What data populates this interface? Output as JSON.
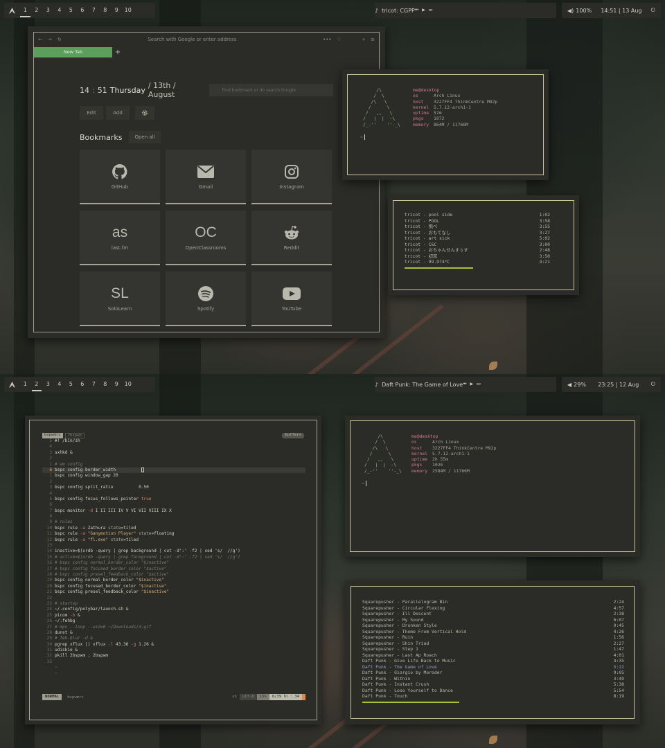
{
  "top": {
    "bar": {
      "workspaces": [
        "1",
        "2",
        "3",
        "4",
        "5",
        "6",
        "7",
        "8",
        "9",
        "10"
      ],
      "active": 0,
      "now_playing": "tricot: CGPP",
      "volume": "100%",
      "clock": "14:51 | 13 Aug"
    },
    "browser": {
      "address_placeholder": "Search with Google or enter address",
      "tab": "New Tab",
      "time_hour": "14",
      "time_minute": "51",
      "day": "Thursday",
      "date_rest": "/ 13th / August",
      "search_placeholder": "Find bookmark or do search Google",
      "edit": "Edit",
      "add": "Add",
      "bookmarks_heading": "Bookmarks",
      "open_all": "Open all",
      "bookmarks": [
        {
          "label": "GitHub",
          "icon": "github-icon"
        },
        {
          "label": "Gmail",
          "icon": "mail-icon"
        },
        {
          "label": "Instagram",
          "icon": "instagram-icon"
        },
        {
          "label": "last.fm",
          "icon": "lastfm-icon",
          "glyph": "as"
        },
        {
          "label": "OpenClassrooms",
          "icon": "openclassrooms-icon",
          "glyph": "OC"
        },
        {
          "label": "Reddit",
          "icon": "reddit-icon"
        },
        {
          "label": "SoloLearn",
          "icon": "sololearn-icon",
          "glyph": "SL"
        },
        {
          "label": "Spotify",
          "icon": "spotify-icon"
        },
        {
          "label": "YouTube",
          "icon": "youtube-icon"
        }
      ]
    },
    "neofetch": {
      "userhost": "me@desktop",
      "rows": [
        {
          "k": "os",
          "v": "Arch Linux"
        },
        {
          "k": "host",
          "v": "3227FF4 ThinkCentre M92p"
        },
        {
          "k": "kernel",
          "v": "5.7.12-arch1-1"
        },
        {
          "k": "uptime",
          "v": "57m"
        },
        {
          "k": "pkgs",
          "v": "1072"
        },
        {
          "k": "memory",
          "v": "864M / 11766M"
        }
      ],
      "prompt": "~"
    },
    "playlist": [
      {
        "t": "tricot - pool side",
        "d": "1:02"
      },
      {
        "t": "tricot - POOL",
        "d": "3:58"
      },
      {
        "t": "tricot - 飛べ",
        "d": "3:55"
      },
      {
        "t": "tricot - おもてなし",
        "d": "3:27"
      },
      {
        "t": "tricot - art sick",
        "d": "5:02"
      },
      {
        "t": "tricot - C&C",
        "d": "3:00"
      },
      {
        "t": "tricot - おちゃんせんすぅす",
        "d": "2:48"
      },
      {
        "t": "tricot - 初耳",
        "d": "3:50"
      },
      {
        "t": "tricot - 99.974℃",
        "d": "4:21"
      }
    ],
    "playlist_progress": 0.47
  },
  "bottom": {
    "bar": {
      "workspaces": [
        "1",
        "2",
        "3",
        "4",
        "5",
        "6",
        "7",
        "8",
        "9",
        "10"
      ],
      "active": 1,
      "now_playing": "Daft Punk: The Game of Love",
      "volume": "29%",
      "clock": "23:25 | 12 Aug"
    },
    "vim": {
      "tab_active": "bspwmrc",
      "tab_other": "2bspwm",
      "buffers": "buffers",
      "mode": "NORMAL",
      "file": "bspwmrc",
      "ft": "sh",
      "enc": "utf-8",
      "percent": "15%",
      "pos": "6/39 ㏑ : 34"
    },
    "neofetch": {
      "userhost": "me@desktop",
      "rows": [
        {
          "k": "os",
          "v": "Arch Linux"
        },
        {
          "k": "host",
          "v": "3227FF4 ThinkCentre M92p"
        },
        {
          "k": "kernel",
          "v": "5.7.12-arch1-1"
        },
        {
          "k": "uptime",
          "v": "2h 55m"
        },
        {
          "k": "pkgs",
          "v": "1026"
        },
        {
          "k": "memory",
          "v": "2584M / 11766M"
        }
      ],
      "prompt": "~"
    },
    "playlist": [
      {
        "t": "Squarepusher - Parallelogram Bin",
        "d": "2:24"
      },
      {
        "t": "Squarepusher - Circular Flexing",
        "d": "4:57"
      },
      {
        "t": "Squarepusher - Ill Descent",
        "d": "2:38"
      },
      {
        "t": "Squarepusher - My Sound",
        "d": "6:07"
      },
      {
        "t": "Squarepusher - Drunken Style",
        "d": "0:45"
      },
      {
        "t": "Squarepusher - Theme From Vertical Hold",
        "d": "4:26"
      },
      {
        "t": "Squarepusher - Ruin",
        "d": "1:56"
      },
      {
        "t": "Squarepusher - Shin Triad",
        "d": "2:27"
      },
      {
        "t": "Squarepusher - Step 1",
        "d": "1:47"
      },
      {
        "t": "Squarepusher - Last Ap Roach",
        "d": "4:01"
      },
      {
        "t": "Daft Punk - Give Life Back to Music",
        "d": "4:35"
      },
      {
        "t": "Daft Punk - The Game of Love",
        "d": "5:22",
        "playing": true
      },
      {
        "t": "Daft Punk - Giorgio by Moroder",
        "d": "9:05"
      },
      {
        "t": "Daft Punk - Within",
        "d": "3:49"
      },
      {
        "t": "Daft Punk - Instant Crush",
        "d": "5:38"
      },
      {
        "t": "Daft Punk - Lose Yourself to Dance",
        "d": "5:54"
      },
      {
        "t": "Daft Punk - Touch",
        "d": "8:19"
      }
    ],
    "playlist_progress": 0.37
  },
  "ascii_logo": "     /\\\n    /  \\\n   /\\   \\\n  /      \\\n /   ,,   \\\n/   |  |  -\\\n/_-''    ''-_\\",
  "code": [
    {
      "n": "5",
      "h": [
        [
          "txt",
          "#! /bin/sh"
        ]
      ]
    },
    {
      "n": "4",
      "h": []
    },
    {
      "n": "3",
      "h": [
        [
          "txt",
          "sxhkd &"
        ]
      ]
    },
    {
      "n": "2",
      "h": []
    },
    {
      "n": "1",
      "h": [
        [
          "cm",
          "# wm config"
        ]
      ]
    },
    {
      "n": "6",
      "cur": true,
      "h": [
        [
          "txt",
          "bspc config border_width          "
        ],
        [
          "box",
          ""
        ]
      ]
    },
    {
      "n": "1",
      "h": [
        [
          "txt",
          "bspc config window_gap 20"
        ]
      ]
    },
    {
      "n": "2",
      "h": []
    },
    {
      "n": "3",
      "h": [
        [
          "txt",
          "bspc config split_ratio          0.50"
        ]
      ]
    },
    {
      "n": "4",
      "h": []
    },
    {
      "n": "5",
      "h": [
        [
          "txt",
          "bspc config focus_follows_pointer "
        ],
        [
          "or",
          "true"
        ]
      ]
    },
    {
      "n": "6",
      "h": []
    },
    {
      "n": "7",
      "h": [
        [
          "txt",
          "bspc monitor "
        ],
        [
          "pk",
          "-d"
        ],
        [
          "txt",
          " I II III IV V VI VII VIII IX X"
        ]
      ]
    },
    {
      "n": "8",
      "h": []
    },
    {
      "n": "9",
      "h": [
        [
          "cm",
          "# rules"
        ]
      ]
    },
    {
      "n": "10",
      "h": [
        [
          "txt",
          "bspc rule "
        ],
        [
          "pk",
          "-a"
        ],
        [
          "txt",
          " Zathura "
        ],
        [
          "kw",
          "state"
        ],
        [
          "txt",
          "=tiled"
        ]
      ]
    },
    {
      "n": "11",
      "h": [
        [
          "txt",
          "bspc rule "
        ],
        [
          "pk",
          "-a"
        ],
        [
          "txt",
          " "
        ],
        [
          "st",
          "\"Ganymotion Player\""
        ],
        [
          "txt",
          " "
        ],
        [
          "kw",
          "state"
        ],
        [
          "txt",
          "=floating"
        ]
      ]
    },
    {
      "n": "12",
      "h": [
        [
          "txt",
          "bspc rule "
        ],
        [
          "pk",
          "-a"
        ],
        [
          "txt",
          " "
        ],
        [
          "st",
          "\"fl.exe\""
        ],
        [
          "txt",
          " "
        ],
        [
          "kw",
          "state"
        ],
        [
          "txt",
          "=tiled"
        ]
      ]
    },
    {
      "n": "13",
      "h": []
    },
    {
      "n": "14",
      "h": [
        [
          "txt",
          "inactive=$(xrdb -query | grep background | cut -d':' -f2 | sed 's/  //g')"
        ]
      ]
    },
    {
      "n": "15",
      "h": [
        [
          "cm",
          "# active=$(xrdb -query | grep foreground | cut -d':' -f2 | sed 's/  //g')"
        ]
      ]
    },
    {
      "n": "16",
      "h": [
        [
          "cm",
          "# bspc config normal_border_color \"$inactive\""
        ]
      ]
    },
    {
      "n": "17",
      "h": [
        [
          "cm",
          "# bspc config focused_border_color \"$active\""
        ]
      ]
    },
    {
      "n": "18",
      "h": [
        [
          "cm",
          "# bspc config presel_feedback_color \"$active\""
        ]
      ]
    },
    {
      "n": "19",
      "h": [
        [
          "txt",
          "bspc config normal_border_color "
        ],
        [
          "st",
          "\"$inactive\""
        ]
      ]
    },
    {
      "n": "20",
      "h": [
        [
          "txt",
          "bspc config focused_border_color "
        ],
        [
          "st",
          "\"$inactive\""
        ]
      ]
    },
    {
      "n": "21",
      "h": [
        [
          "txt",
          "bspc config presel_feedback_color "
        ],
        [
          "st",
          "\"$inactive\""
        ]
      ]
    },
    {
      "n": "22",
      "h": []
    },
    {
      "n": "23",
      "h": [
        [
          "cm",
          "# startup"
        ]
      ]
    },
    {
      "n": "24",
      "h": [
        [
          "txt",
          "~/.config/polybar/launch.sh &"
        ]
      ]
    },
    {
      "n": "25",
      "h": [
        [
          "txt",
          "picom "
        ],
        [
          "pk",
          "-b"
        ],
        [
          "txt",
          " &"
        ]
      ]
    },
    {
      "n": "26",
      "h": [
        [
          "txt",
          "~/.fehbg"
        ]
      ]
    },
    {
      "n": "27",
      "h": [
        [
          "cm",
          "# mpv --loop --wid=0 ~/Downloads/d.gif"
        ]
      ]
    },
    {
      "n": "28",
      "h": [
        [
          "txt",
          "dunst &"
        ]
      ]
    },
    {
      "n": "29",
      "h": [
        [
          "cm",
          "# feh-blur -d &"
        ]
      ]
    },
    {
      "n": "30",
      "h": [
        [
          "txt",
          "pgrep xflux || xflux "
        ],
        [
          "pk",
          "-l"
        ],
        [
          "txt",
          " 43.36 "
        ],
        [
          "pk",
          "-g"
        ],
        [
          "txt",
          " 1.26 &"
        ]
      ]
    },
    {
      "n": "31",
      "h": [
        [
          "txt",
          "udiskie &"
        ]
      ]
    },
    {
      "n": "32",
      "h": [
        [
          "txt",
          "pkill 2bspwm ; 2bspwm"
        ]
      ]
    },
    {
      "n": "33",
      "h": []
    },
    {
      "n": "",
      "h": [
        [
          "tl",
          "~"
        ]
      ]
    },
    {
      "n": "",
      "h": [
        [
          "tl",
          "~"
        ]
      ]
    }
  ]
}
